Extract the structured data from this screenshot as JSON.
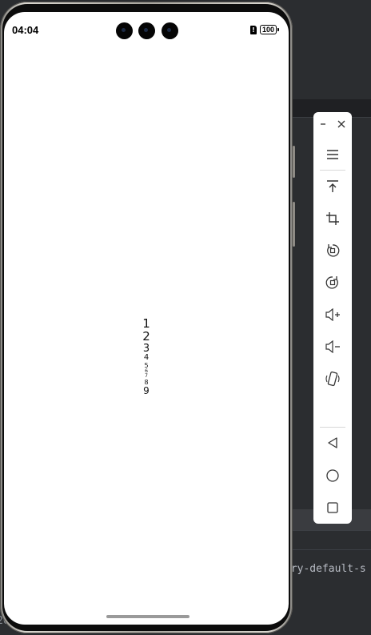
{
  "status_bar": {
    "time": "04:04",
    "battery": "100",
    "sim_alert": "!"
  },
  "content": {
    "numbers": [
      {
        "label": "1",
        "size": 15
      },
      {
        "label": "2",
        "size": 15
      },
      {
        "label": "3",
        "size": 13
      },
      {
        "label": "4",
        "size": 10
      },
      {
        "label": "5",
        "size": 8
      },
      {
        "label": "6",
        "size": 6
      },
      {
        "label": "7",
        "size": 6
      },
      {
        "label": "8",
        "size": 8
      },
      {
        "label": "9",
        "size": 12
      }
    ]
  },
  "toolbar": {
    "items": [
      {
        "icon": "minimize-icon"
      },
      {
        "icon": "close-icon"
      },
      {
        "icon": "menu-icon"
      },
      {
        "icon": "pin-to-top-icon"
      },
      {
        "icon": "crop-screenshot-icon"
      },
      {
        "icon": "rotate-left-icon"
      },
      {
        "icon": "rotate-right-icon"
      },
      {
        "icon": "volume-up-icon"
      },
      {
        "icon": "volume-down-icon"
      },
      {
        "icon": "shake-device-icon"
      },
      {
        "icon": "back-icon"
      },
      {
        "icon": "home-icon"
      },
      {
        "icon": "recents-icon"
      }
    ]
  },
  "ide": {
    "console_text": "try-default-s",
    "left_fragment": "26"
  },
  "colors": {
    "ide_background": "#2b2d30",
    "screen_background": "#ffffff",
    "toolbar_background": "#ffffff"
  }
}
